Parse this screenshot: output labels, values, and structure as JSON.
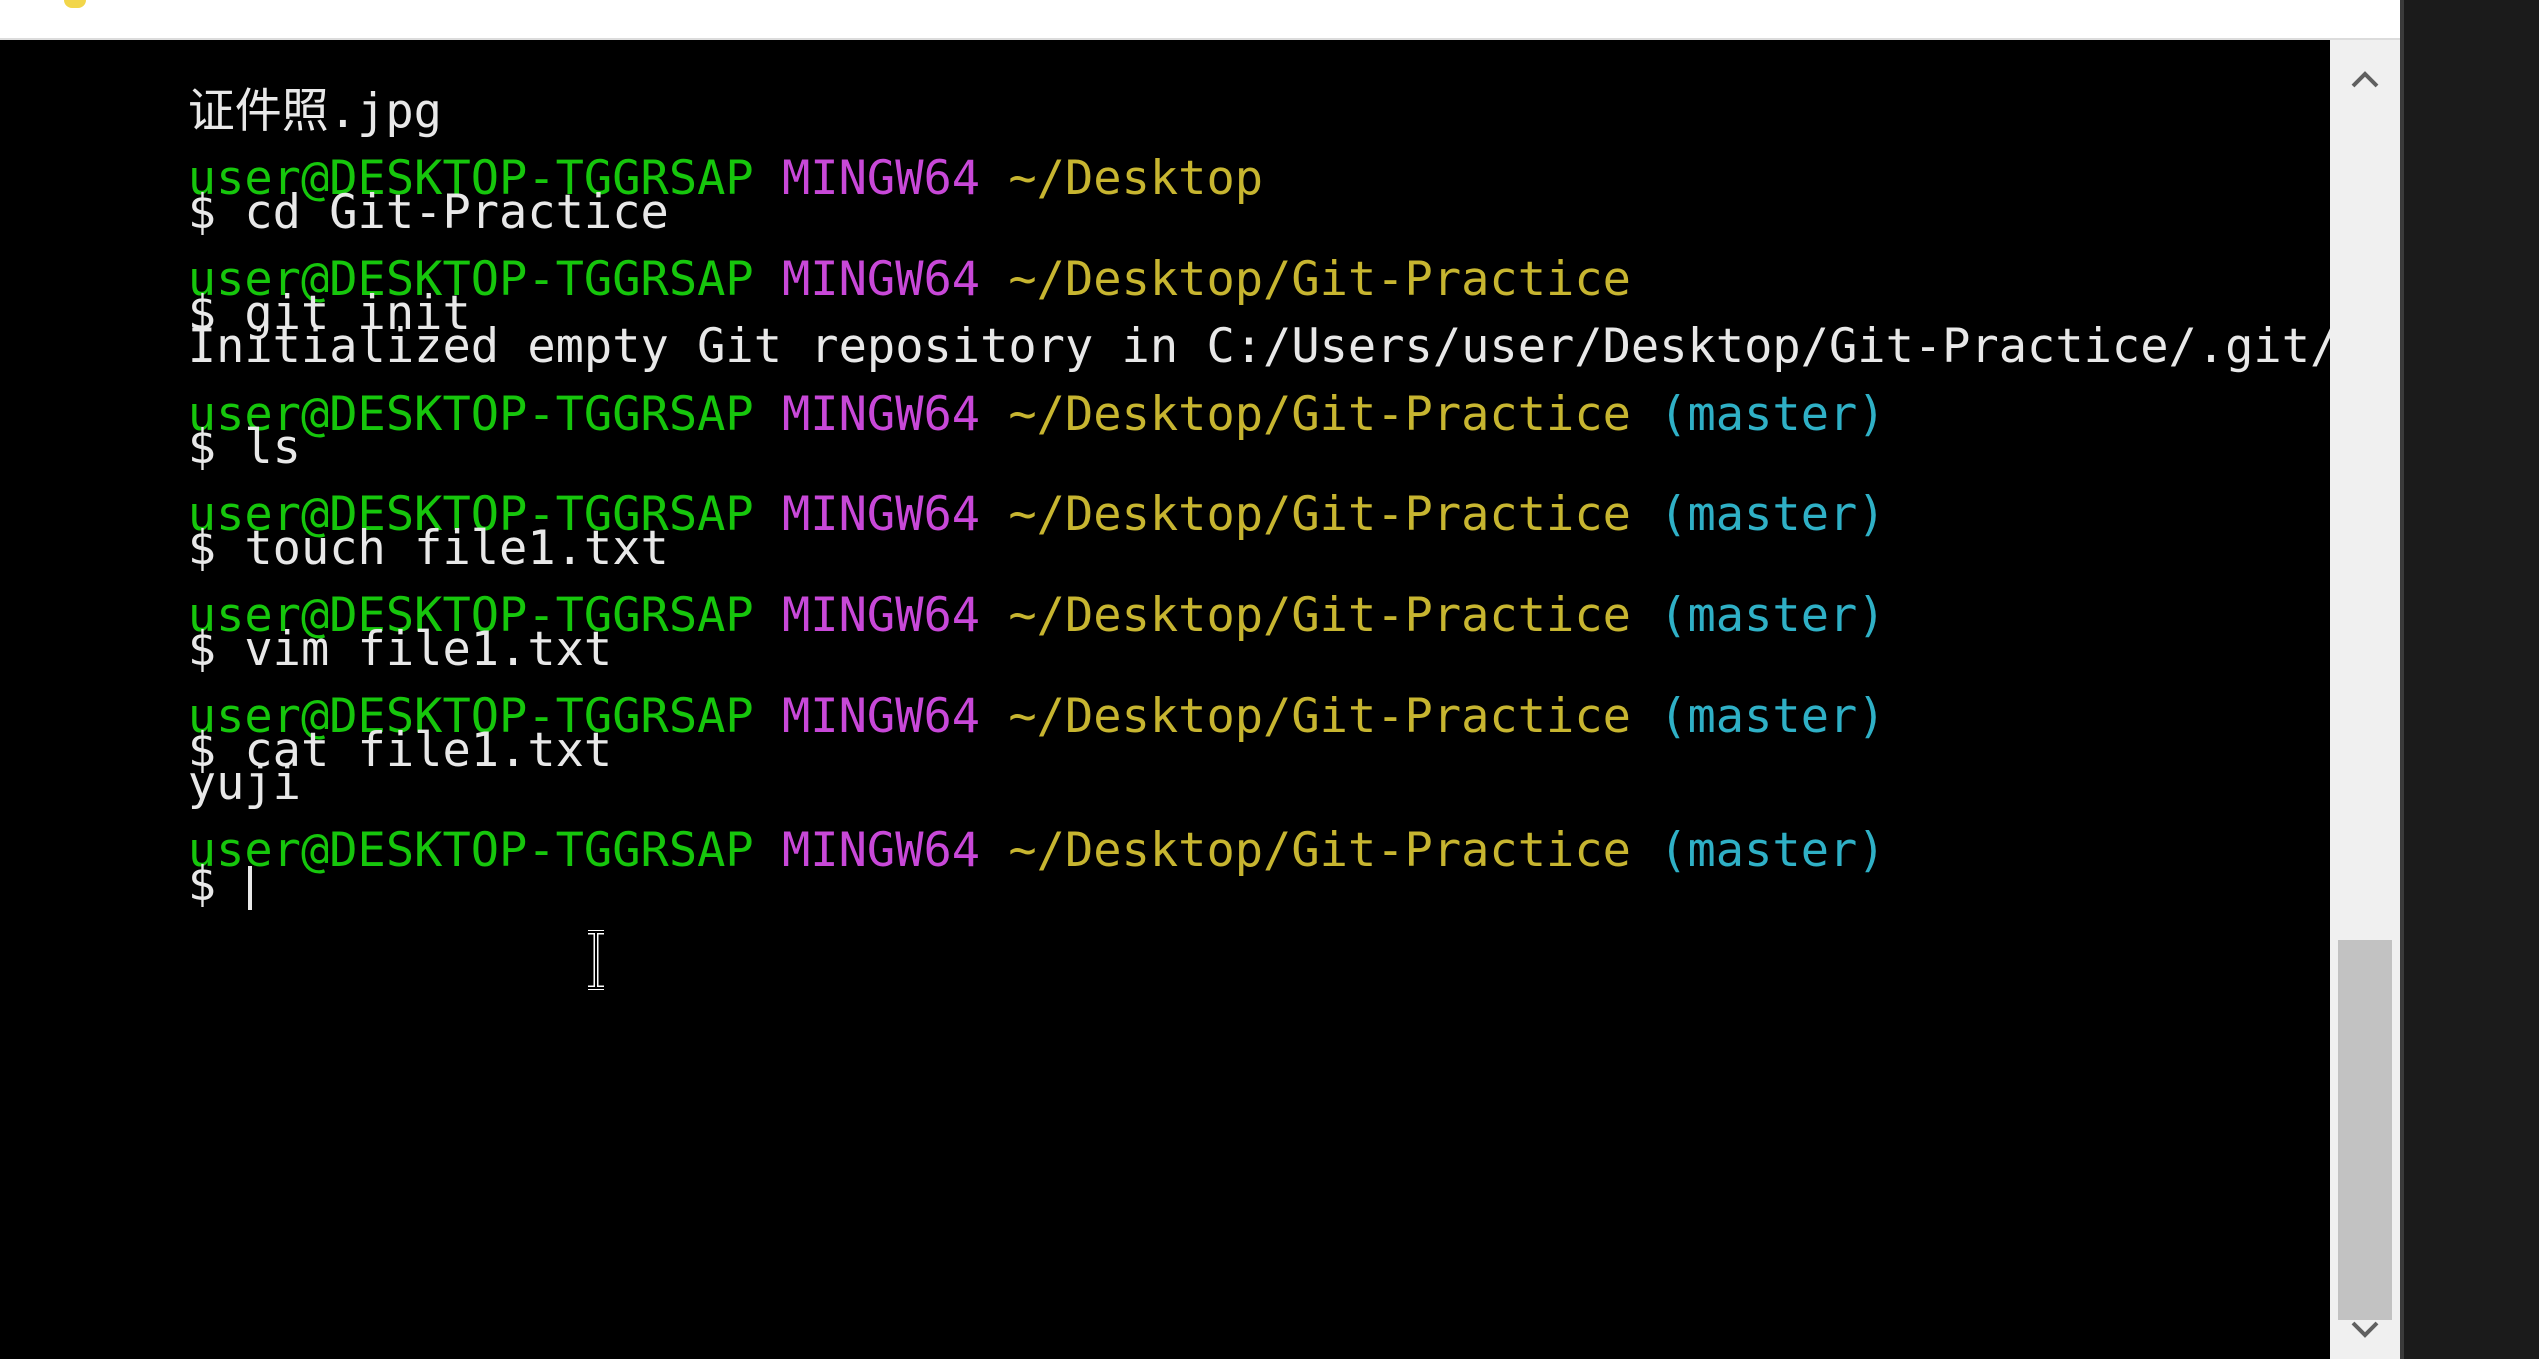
{
  "terminal": {
    "lines": [
      {
        "type": "text",
        "text": "证件照.jpg"
      },
      {
        "type": "prompt",
        "user": "user@DESKTOP-TGGRSAP",
        "system": "MINGW64",
        "path": "~/Desktop",
        "branch": ""
      },
      {
        "type": "text",
        "text": "$ cd Git-Practice"
      },
      {
        "type": "prompt",
        "user": "user@DESKTOP-TGGRSAP",
        "system": "MINGW64",
        "path": "~/Desktop/Git-Practice",
        "branch": ""
      },
      {
        "type": "text",
        "text": "$ git init"
      },
      {
        "type": "text",
        "text": "Initialized empty Git repository in C:/Users/user/Desktop/Git-Practice/.git/"
      },
      {
        "type": "prompt",
        "user": "user@DESKTOP-TGGRSAP",
        "system": "MINGW64",
        "path": "~/Desktop/Git-Practice",
        "branch": "(master)"
      },
      {
        "type": "text",
        "text": "$ ls"
      },
      {
        "type": "prompt",
        "user": "user@DESKTOP-TGGRSAP",
        "system": "MINGW64",
        "path": "~/Desktop/Git-Practice",
        "branch": "(master)"
      },
      {
        "type": "text",
        "text": "$ touch file1.txt"
      },
      {
        "type": "prompt",
        "user": "user@DESKTOP-TGGRSAP",
        "system": "MINGW64",
        "path": "~/Desktop/Git-Practice",
        "branch": "(master)"
      },
      {
        "type": "text",
        "text": "$ vim file1.txt"
      },
      {
        "type": "prompt",
        "user": "user@DESKTOP-TGGRSAP",
        "system": "MINGW64",
        "path": "~/Desktop/Git-Practice",
        "branch": "(master)"
      },
      {
        "type": "text",
        "text": "$ cat file1.txt"
      },
      {
        "type": "text",
        "text": "yuji"
      },
      {
        "type": "prompt",
        "user": "user@DESKTOP-TGGRSAP",
        "system": "MINGW64",
        "path": "~/Desktop/Git-Practice",
        "branch": "(master)"
      },
      {
        "type": "text",
        "text": "$ "
      }
    ]
  },
  "colors": {
    "background": "#000000",
    "text": "#e8e8e8",
    "user": "#16c60c",
    "system": "#c848d8",
    "path": "#c7b530",
    "branch": "#2fb0c6"
  },
  "icons": {
    "scroll_up": "chevron-up-icon",
    "scroll_down": "chevron-down-icon",
    "text_cursor": "text-cursor-icon"
  }
}
